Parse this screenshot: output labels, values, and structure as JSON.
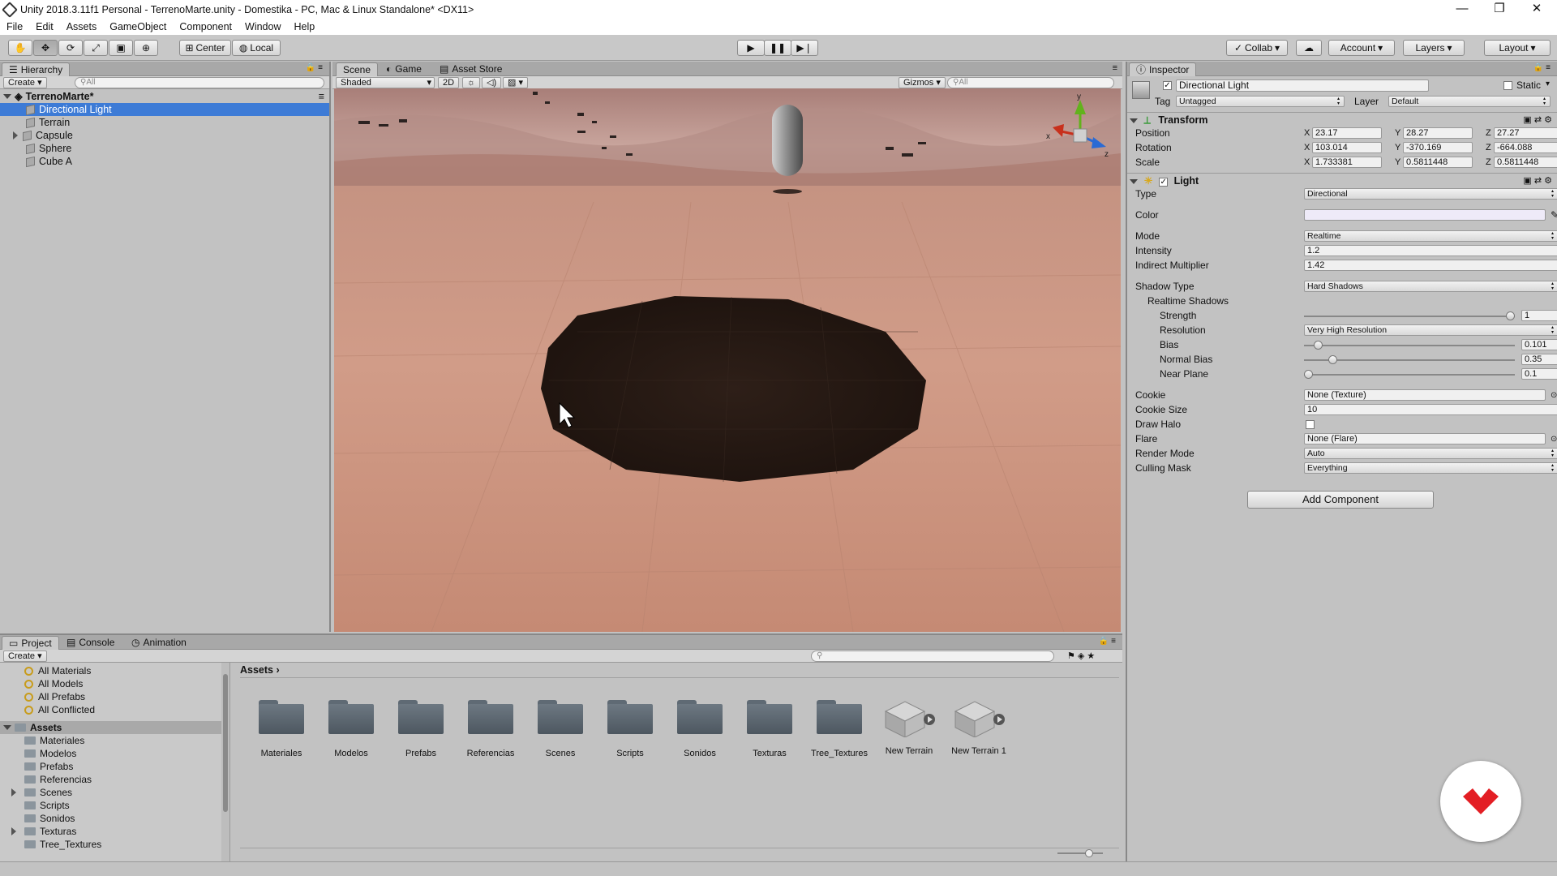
{
  "window": {
    "title": "Unity 2018.3.11f1 Personal - TerrenoMarte.unity - Domestika - PC, Mac & Linux Standalone* <DX11>",
    "minimize": "—",
    "restore": "❐",
    "close": "✕"
  },
  "menu": [
    "File",
    "Edit",
    "Assets",
    "GameObject",
    "Component",
    "Window",
    "Help"
  ],
  "toolbar": {
    "pivot": "Center",
    "space": "Local",
    "collab": "Collab",
    "account": "Account",
    "layers": "Layers",
    "layout": "Layout"
  },
  "hierarchy": {
    "tab": "Hierarchy",
    "create": "Create",
    "search_placeholder": "All",
    "scene": "TerrenoMarte*",
    "items": [
      "Directional Light",
      "Terrain",
      "Capsule",
      "Sphere",
      "Cube A"
    ],
    "selected_index": 0
  },
  "scene_view": {
    "tabs": [
      "Scene",
      "Game",
      "Asset Store"
    ],
    "shading": "Shaded",
    "mode_2d": "2D",
    "gizmos": "Gizmos",
    "search_placeholder": "All"
  },
  "inspector": {
    "tab": "Inspector",
    "object_name": "Directional Light",
    "static_label": "Static",
    "tag_label": "Tag",
    "tag": "Untagged",
    "layer_label": "Layer",
    "layer": "Default",
    "transform": {
      "header": "Transform",
      "position_label": "Position",
      "rotation_label": "Rotation",
      "scale_label": "Scale",
      "position": [
        "23.17",
        "28.27",
        "27.27"
      ],
      "rotation": [
        "103.014",
        "-370.169",
        "-664.088"
      ],
      "scale": [
        "1.733381",
        "0.5811448",
        "0.5811448"
      ]
    },
    "light": {
      "header": "Light",
      "type_label": "Type",
      "type": "Directional",
      "color_label": "Color",
      "color": "#eeeaf8",
      "mode_label": "Mode",
      "mode": "Realtime",
      "intensity_label": "Intensity",
      "intensity": "1.2",
      "indirect_label": "Indirect Multiplier",
      "indirect": "1.42",
      "shadow_type_label": "Shadow Type",
      "shadow_type": "Hard Shadows",
      "realtime_shadows_label": "Realtime Shadows",
      "strength_label": "Strength",
      "strength": "1",
      "strength_frac": 1.0,
      "resolution_label": "Resolution",
      "resolution": "Very High Resolution",
      "bias_label": "Bias",
      "bias": "0.101",
      "bias_frac": 0.05,
      "normal_bias_label": "Normal Bias",
      "normal_bias": "0.35",
      "normal_bias_frac": 0.12,
      "near_plane_label": "Near Plane",
      "near_plane": "0.1",
      "near_plane_frac": 0.0,
      "cookie_label": "Cookie",
      "cookie": "None (Texture)",
      "cookie_size_label": "Cookie Size",
      "cookie_size": "10",
      "draw_halo_label": "Draw Halo",
      "flare_label": "Flare",
      "flare": "None (Flare)",
      "render_mode_label": "Render Mode",
      "render_mode": "Auto",
      "culling_mask_label": "Culling Mask",
      "culling_mask": "Everything"
    },
    "add_component": "Add Component"
  },
  "project": {
    "tabs": [
      "Project",
      "Console",
      "Animation"
    ],
    "create": "Create",
    "favorites": [
      "All Materials",
      "All Models",
      "All Prefabs",
      "All Conflicted"
    ],
    "assets_root": "Assets",
    "tree": [
      "Materiales",
      "Modelos",
      "Prefabs",
      "Referencias",
      "Scenes",
      "Scripts",
      "Sonidos",
      "Texturas",
      "Tree_Textures"
    ],
    "breadcrumb": "Assets",
    "folders": [
      "Materiales",
      "Modelos",
      "Prefabs",
      "Referencias",
      "Scenes",
      "Scripts",
      "Sonidos",
      "Texturas",
      "Tree_Textures"
    ],
    "terrains": [
      "New Terrain",
      "New Terrain 1"
    ]
  },
  "gizmo_axes": {
    "y": "y",
    "x": "x",
    "z": "z"
  }
}
